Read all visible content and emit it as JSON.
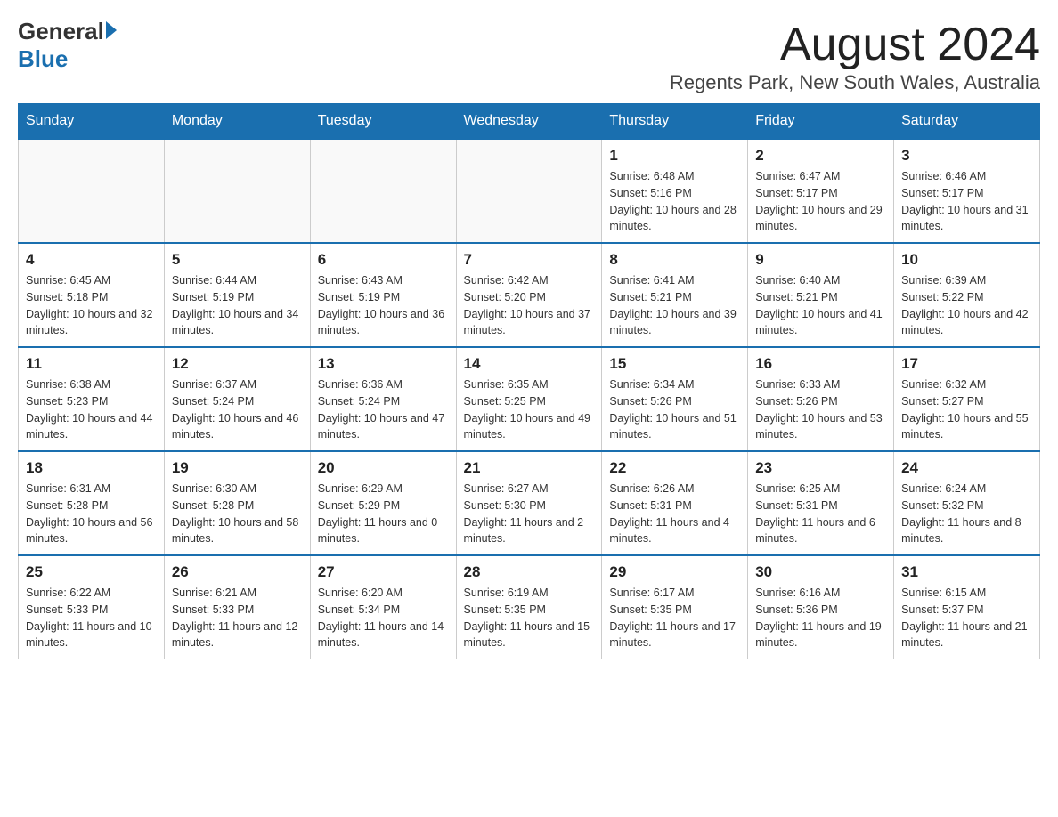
{
  "header": {
    "logo_general": "General",
    "logo_blue": "Blue",
    "month_title": "August 2024",
    "location": "Regents Park, New South Wales, Australia"
  },
  "days_of_week": [
    "Sunday",
    "Monday",
    "Tuesday",
    "Wednesday",
    "Thursday",
    "Friday",
    "Saturday"
  ],
  "weeks": [
    {
      "days": [
        {
          "number": "",
          "info": ""
        },
        {
          "number": "",
          "info": ""
        },
        {
          "number": "",
          "info": ""
        },
        {
          "number": "",
          "info": ""
        },
        {
          "number": "1",
          "info": "Sunrise: 6:48 AM\nSunset: 5:16 PM\nDaylight: 10 hours and 28 minutes."
        },
        {
          "number": "2",
          "info": "Sunrise: 6:47 AM\nSunset: 5:17 PM\nDaylight: 10 hours and 29 minutes."
        },
        {
          "number": "3",
          "info": "Sunrise: 6:46 AM\nSunset: 5:17 PM\nDaylight: 10 hours and 31 minutes."
        }
      ]
    },
    {
      "days": [
        {
          "number": "4",
          "info": "Sunrise: 6:45 AM\nSunset: 5:18 PM\nDaylight: 10 hours and 32 minutes."
        },
        {
          "number": "5",
          "info": "Sunrise: 6:44 AM\nSunset: 5:19 PM\nDaylight: 10 hours and 34 minutes."
        },
        {
          "number": "6",
          "info": "Sunrise: 6:43 AM\nSunset: 5:19 PM\nDaylight: 10 hours and 36 minutes."
        },
        {
          "number": "7",
          "info": "Sunrise: 6:42 AM\nSunset: 5:20 PM\nDaylight: 10 hours and 37 minutes."
        },
        {
          "number": "8",
          "info": "Sunrise: 6:41 AM\nSunset: 5:21 PM\nDaylight: 10 hours and 39 minutes."
        },
        {
          "number": "9",
          "info": "Sunrise: 6:40 AM\nSunset: 5:21 PM\nDaylight: 10 hours and 41 minutes."
        },
        {
          "number": "10",
          "info": "Sunrise: 6:39 AM\nSunset: 5:22 PM\nDaylight: 10 hours and 42 minutes."
        }
      ]
    },
    {
      "days": [
        {
          "number": "11",
          "info": "Sunrise: 6:38 AM\nSunset: 5:23 PM\nDaylight: 10 hours and 44 minutes."
        },
        {
          "number": "12",
          "info": "Sunrise: 6:37 AM\nSunset: 5:24 PM\nDaylight: 10 hours and 46 minutes."
        },
        {
          "number": "13",
          "info": "Sunrise: 6:36 AM\nSunset: 5:24 PM\nDaylight: 10 hours and 47 minutes."
        },
        {
          "number": "14",
          "info": "Sunrise: 6:35 AM\nSunset: 5:25 PM\nDaylight: 10 hours and 49 minutes."
        },
        {
          "number": "15",
          "info": "Sunrise: 6:34 AM\nSunset: 5:26 PM\nDaylight: 10 hours and 51 minutes."
        },
        {
          "number": "16",
          "info": "Sunrise: 6:33 AM\nSunset: 5:26 PM\nDaylight: 10 hours and 53 minutes."
        },
        {
          "number": "17",
          "info": "Sunrise: 6:32 AM\nSunset: 5:27 PM\nDaylight: 10 hours and 55 minutes."
        }
      ]
    },
    {
      "days": [
        {
          "number": "18",
          "info": "Sunrise: 6:31 AM\nSunset: 5:28 PM\nDaylight: 10 hours and 56 minutes."
        },
        {
          "number": "19",
          "info": "Sunrise: 6:30 AM\nSunset: 5:28 PM\nDaylight: 10 hours and 58 minutes."
        },
        {
          "number": "20",
          "info": "Sunrise: 6:29 AM\nSunset: 5:29 PM\nDaylight: 11 hours and 0 minutes."
        },
        {
          "number": "21",
          "info": "Sunrise: 6:27 AM\nSunset: 5:30 PM\nDaylight: 11 hours and 2 minutes."
        },
        {
          "number": "22",
          "info": "Sunrise: 6:26 AM\nSunset: 5:31 PM\nDaylight: 11 hours and 4 minutes."
        },
        {
          "number": "23",
          "info": "Sunrise: 6:25 AM\nSunset: 5:31 PM\nDaylight: 11 hours and 6 minutes."
        },
        {
          "number": "24",
          "info": "Sunrise: 6:24 AM\nSunset: 5:32 PM\nDaylight: 11 hours and 8 minutes."
        }
      ]
    },
    {
      "days": [
        {
          "number": "25",
          "info": "Sunrise: 6:22 AM\nSunset: 5:33 PM\nDaylight: 11 hours and 10 minutes."
        },
        {
          "number": "26",
          "info": "Sunrise: 6:21 AM\nSunset: 5:33 PM\nDaylight: 11 hours and 12 minutes."
        },
        {
          "number": "27",
          "info": "Sunrise: 6:20 AM\nSunset: 5:34 PM\nDaylight: 11 hours and 14 minutes."
        },
        {
          "number": "28",
          "info": "Sunrise: 6:19 AM\nSunset: 5:35 PM\nDaylight: 11 hours and 15 minutes."
        },
        {
          "number": "29",
          "info": "Sunrise: 6:17 AM\nSunset: 5:35 PM\nDaylight: 11 hours and 17 minutes."
        },
        {
          "number": "30",
          "info": "Sunrise: 6:16 AM\nSunset: 5:36 PM\nDaylight: 11 hours and 19 minutes."
        },
        {
          "number": "31",
          "info": "Sunrise: 6:15 AM\nSunset: 5:37 PM\nDaylight: 11 hours and 21 minutes."
        }
      ]
    }
  ]
}
